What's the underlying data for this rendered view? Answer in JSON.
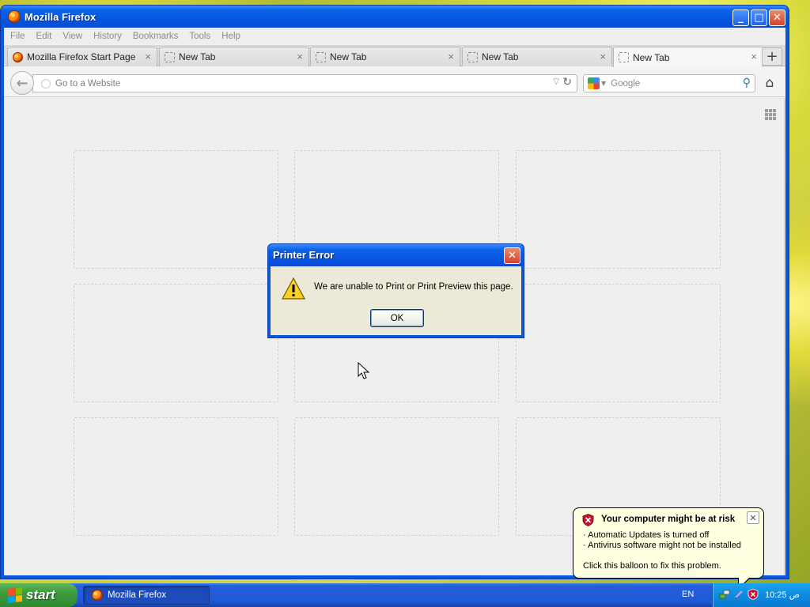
{
  "window": {
    "title": "Mozilla Firefox",
    "buttons": {
      "minimize": "_",
      "maximize": "□",
      "close": "✕"
    }
  },
  "menubar": {
    "items": [
      "File",
      "Edit",
      "View",
      "History",
      "Bookmarks",
      "Tools",
      "Help"
    ]
  },
  "tabs": [
    {
      "label": "Mozilla Firefox Start Page",
      "icon": "firefox-icon",
      "active": false
    },
    {
      "label": "New Tab",
      "icon": "blank-page-icon",
      "active": false
    },
    {
      "label": "New Tab",
      "icon": "blank-page-icon",
      "active": false
    },
    {
      "label": "New Tab",
      "icon": "blank-page-icon",
      "active": false
    },
    {
      "label": "New Tab",
      "icon": "blank-page-icon",
      "active": true
    }
  ],
  "tab_close_glyph": "×",
  "new_tab_glyph": "+",
  "navbar": {
    "back_glyph": "←",
    "url_placeholder": "Go to a Website",
    "dropmarker_glyph": "▽",
    "reload_glyph": "↻",
    "search_placeholder": "Google",
    "engine_drop_glyph": "▼",
    "search_glyph": "⚲",
    "home_glyph": "⌂"
  },
  "dialog": {
    "title": "Printer Error",
    "message": "We are unable to Print or Print Preview this page.",
    "ok_label": "OK",
    "close_glyph": "✕"
  },
  "balloon": {
    "title": "Your computer might be at risk",
    "lines": [
      "· Automatic Updates is turned off",
      "· Antivirus software might not be installed",
      "Click this balloon to fix this problem."
    ],
    "close_glyph": "✕"
  },
  "taskbar": {
    "start_label": "start",
    "task_label": "Mozilla Firefox",
    "language": "EN",
    "clock": "10:25 ص"
  },
  "colors": {
    "titlebar_blue": "#0554e1",
    "dialog_face": "#ece9d8",
    "balloon_bg": "#ffffe1",
    "start_green": "#3d9a3d"
  }
}
